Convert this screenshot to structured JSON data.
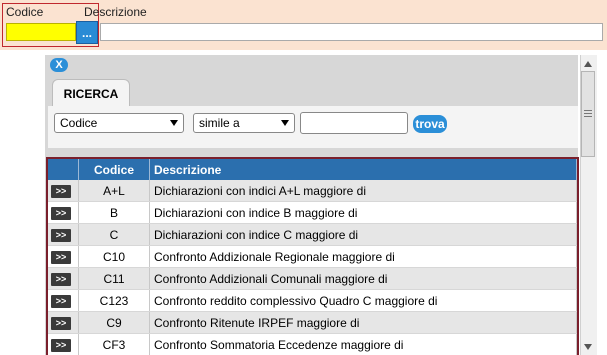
{
  "header": {
    "codice_label": "Codice",
    "descrizione_label": "Descrizione",
    "lookup_button_label": "...",
    "codice_value": "",
    "descrizione_value": ""
  },
  "dialog": {
    "close_label": "X",
    "tab_label": "RICERCA",
    "field_select_value": "Codice",
    "operator_select_value": "simile a",
    "search_value": "",
    "find_button_label": "trova"
  },
  "table": {
    "columns": [
      "Codice",
      "Descrizione"
    ],
    "row_button_label": ">>",
    "rows": [
      {
        "codice": "A+L",
        "descrizione": "Dichiarazioni con indici A+L maggiore di"
      },
      {
        "codice": "B",
        "descrizione": "Dichiarazioni con indice B maggiore di"
      },
      {
        "codice": "C",
        "descrizione": "Dichiarazioni con indice C maggiore di"
      },
      {
        "codice": "C10",
        "descrizione": "Confronto Addizionale Regionale maggiore di"
      },
      {
        "codice": "C11",
        "descrizione": "Confronto Addizionali Comunali maggiore di"
      },
      {
        "codice": "C123",
        "descrizione": "Confronto reddito complessivo Quadro C maggiore di"
      },
      {
        "codice": "C9",
        "descrizione": "Confronto Ritenute IRPEF maggiore di"
      },
      {
        "codice": "CF3",
        "descrizione": "Confronto Sommatoria Eccedenze maggiore di"
      }
    ]
  },
  "colors": {
    "topbar_bg": "#fbe3d1",
    "codice_input_bg": "#ffff00",
    "accent_blue": "#2b8fd8",
    "table_header_bg": "#2b6fae",
    "table_frame_border": "#7a1f2c"
  }
}
